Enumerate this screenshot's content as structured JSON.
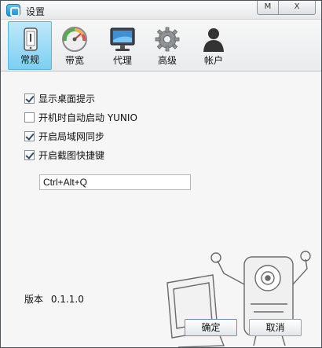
{
  "window": {
    "title": "设置",
    "minimize_label": "M",
    "close_label": "X"
  },
  "tabs": [
    {
      "label": "常规",
      "icon": "phone-icon",
      "active": true
    },
    {
      "label": "带宽",
      "icon": "speedometer-icon",
      "active": false
    },
    {
      "label": "代理",
      "icon": "monitor-icon",
      "active": false
    },
    {
      "label": "高级",
      "icon": "gear-icon",
      "active": false
    },
    {
      "label": "帐户",
      "icon": "user-icon",
      "active": false
    }
  ],
  "options": [
    {
      "label": "显示桌面提示",
      "checked": true
    },
    {
      "label": "开机时自动启动 YUNIO",
      "checked": false
    },
    {
      "label": "开启局域网同步",
      "checked": true
    },
    {
      "label": "开启截图快捷键",
      "checked": true
    }
  ],
  "hotkey": {
    "value": "Ctrl+Alt+Q"
  },
  "version": {
    "label": "版本",
    "value": "0.1.1.0"
  },
  "buttons": {
    "ok": "确定",
    "cancel": "取消"
  },
  "colors": {
    "accent": "#7ccff2",
    "accent_border": "#58b6e2"
  }
}
